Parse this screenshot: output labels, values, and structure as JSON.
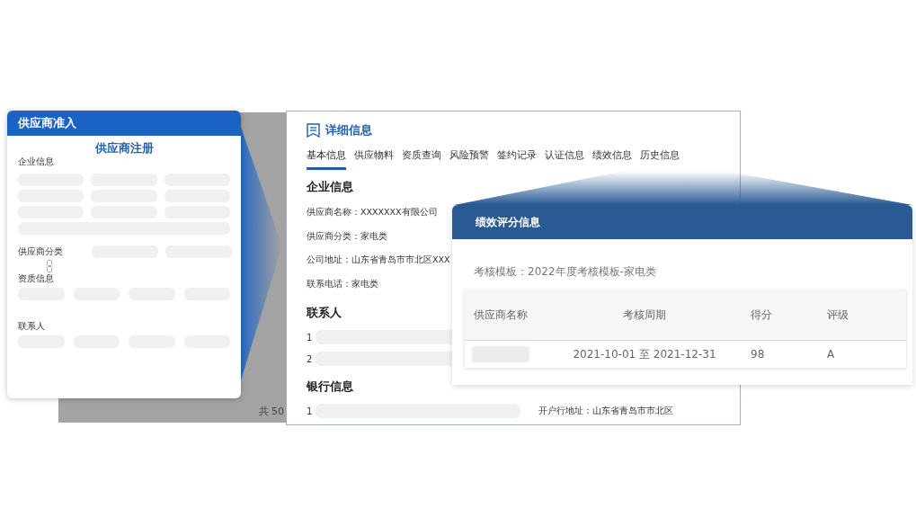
{
  "background_table": {
    "footer": "共 50"
  },
  "admission_card": {
    "title": "供应商准入",
    "form_title": "供应商注册",
    "sections": [
      {
        "label": "企业信息",
        "kind": "grid"
      },
      {
        "label": "供应商分类",
        "kind": "pair"
      },
      {
        "label": "资质信息",
        "kind": "row"
      },
      {
        "label": "联系人",
        "kind": "row"
      }
    ]
  },
  "detail_card": {
    "title": "详细信息",
    "tabs": [
      {
        "label": "基本信息",
        "selected": true
      },
      {
        "label": "供应物料",
        "selected": false
      },
      {
        "label": "资质查询",
        "selected": false
      },
      {
        "label": "风险预警",
        "selected": false
      },
      {
        "label": "签约记录",
        "selected": false
      },
      {
        "label": "认证信息",
        "selected": false
      },
      {
        "label": "绩效信息",
        "selected": false
      },
      {
        "label": "历史信息",
        "selected": false
      }
    ],
    "company": {
      "heading": "企业信息",
      "fields": [
        {
          "label": "供应商名称：",
          "value": "XXXXXXX有限公司"
        },
        {
          "label": "供应商分类：",
          "value": "家电类"
        },
        {
          "label": "公司地址：",
          "value": "山东省青岛市市北区XXX"
        },
        {
          "label": "联系电话：",
          "value": "家电类"
        }
      ]
    },
    "contacts": {
      "heading": "联系人",
      "rows": [
        "1",
        "2"
      ]
    },
    "bank": {
      "heading": "银行信息",
      "rows": [
        {
          "index": "1",
          "address_label": "开户行地址：",
          "address": "山东省青岛市市北区"
        }
      ]
    }
  },
  "performance_card": {
    "title": "绩效评分信息",
    "template": "考核模板：2022年度考核模板-家电类",
    "columns": [
      "供应商名称",
      "考核周期",
      "得分",
      "评级"
    ],
    "rows": [
      {
        "period": "2021-10-01 至 2021-12-31",
        "score": "98",
        "grade": "A"
      }
    ]
  }
}
